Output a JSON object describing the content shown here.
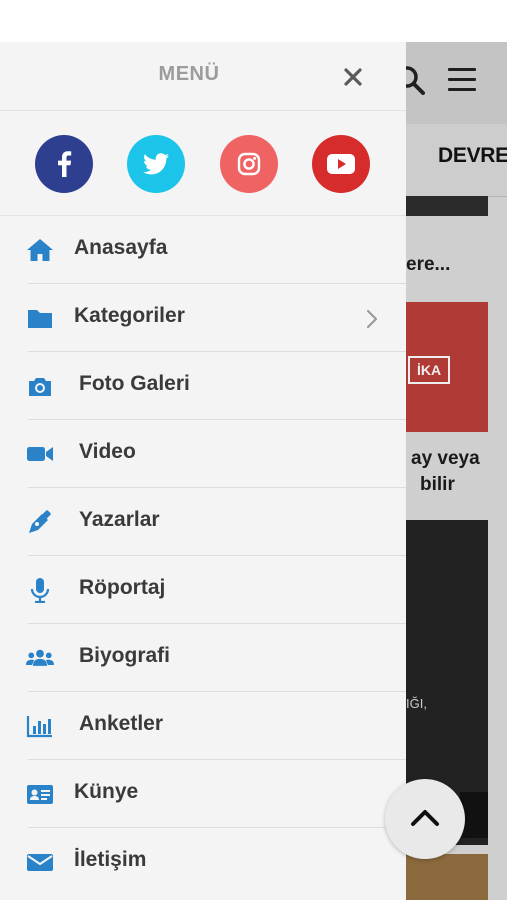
{
  "drawer": {
    "title": "MENÜ",
    "close_icon": "close-icon",
    "social": [
      {
        "name": "facebook",
        "icon": "facebook-icon",
        "color": "#2f3f8f"
      },
      {
        "name": "twitter",
        "icon": "twitter-icon",
        "color": "#1dc4e9"
      },
      {
        "name": "instagram",
        "icon": "instagram-icon",
        "color": "#ef6363"
      },
      {
        "name": "youtube",
        "icon": "youtube-icon",
        "color": "#d72c2c"
      }
    ],
    "items": [
      {
        "label": "Anasayfa",
        "icon": "home-icon"
      },
      {
        "label": "Kategoriler",
        "icon": "folder-icon",
        "has_submenu": true
      },
      {
        "label": "Foto Galeri",
        "icon": "camera-icon"
      },
      {
        "label": "Video",
        "icon": "video-camera-icon"
      },
      {
        "label": "Yazarlar",
        "icon": "pen-icon"
      },
      {
        "label": "Röportaj",
        "icon": "microphone-icon"
      },
      {
        "label": "Biyografi",
        "icon": "users-icon"
      },
      {
        "label": "Anketler",
        "icon": "bar-chart-icon"
      },
      {
        "label": "Künye",
        "icon": "id-card-icon"
      },
      {
        "label": "İletişim",
        "icon": "envelope-icon"
      }
    ]
  },
  "background": {
    "nav_label": "DEVRE",
    "snippet_1": "ere...",
    "image_tag": "İKA",
    "snippet_2_line1": "ay veya",
    "snippet_2_line2": "bilir",
    "caption_fragment": "IĞI,"
  },
  "colors": {
    "accent": "#2a82c9",
    "drawer_bg": "#f4f4f4",
    "text": "#3a3a3a"
  }
}
